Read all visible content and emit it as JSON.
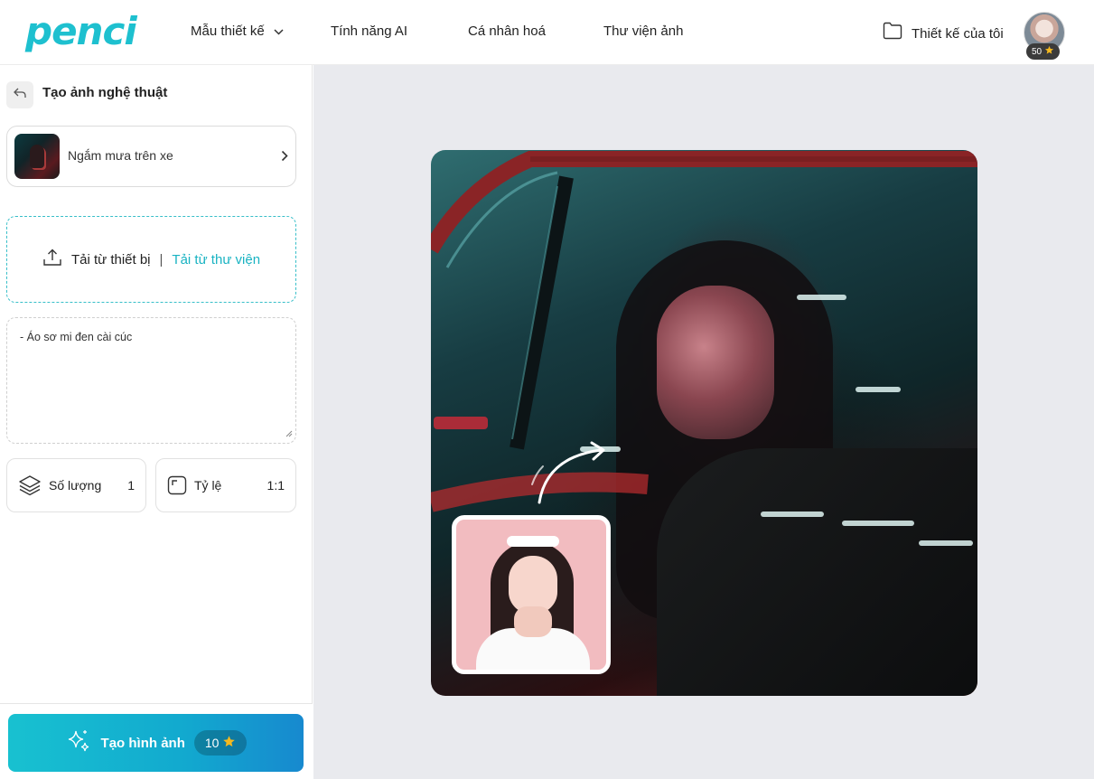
{
  "header": {
    "logo_text": "penci",
    "nav": [
      {
        "label": "Mẫu thiết kế"
      },
      {
        "label": "Tính năng AI"
      },
      {
        "label": "Cá nhân hoá"
      },
      {
        "label": "Thư viện ảnh"
      }
    ],
    "my_designs_label": "Thiết kế của tôi",
    "points": "50"
  },
  "sidebar": {
    "title": "Tạo ảnh nghệ thuật",
    "style_name": "Ngắm mưa trên xe",
    "upload_device_label": "Tải từ thiết bị",
    "upload_separator": "|",
    "upload_library_label": "Tải từ thư viện",
    "prompt_text": "- Áo sơ mi đen cài cúc",
    "quantity_label": "Số lượng",
    "quantity_value": "1",
    "ratio_label": "Tỷ lệ",
    "ratio_value": "1:1",
    "create_label": "Tạo hình ảnh",
    "create_cost": "10"
  },
  "colors": {
    "accent": "#19b3c2",
    "button_gradient_start": "#18c1d0",
    "button_gradient_end": "#1789cf",
    "star": "#f5b91f",
    "canvas_bg": "#e9eaee"
  },
  "icons": {
    "nav_dropdown": "chevron-down-icon",
    "my_designs": "folder-icon",
    "back": "back-arrow-icon",
    "style_next": "chevron-right-icon",
    "upload": "upload-icon",
    "quantity": "layers-icon",
    "ratio": "aspect-ratio-icon",
    "create": "sparkles-icon",
    "points": "star-icon"
  }
}
